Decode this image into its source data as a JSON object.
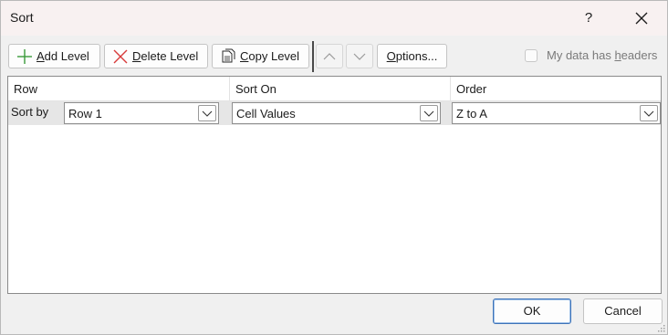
{
  "window": {
    "title": "Sort",
    "help_label": "?"
  },
  "toolbar": {
    "add_level": {
      "accel": "A",
      "rest": "dd Level"
    },
    "delete_level": {
      "accel": "D",
      "rest": "elete Level"
    },
    "copy_level": {
      "accel": "C",
      "rest": "opy Level"
    },
    "options": {
      "accel": "O",
      "rest": "ptions..."
    },
    "headers_checkbox": {
      "label_pre": "My data has ",
      "accel": "h",
      "label_post": "eaders",
      "checked": false
    }
  },
  "grid": {
    "columns": [
      "Row",
      "Sort On",
      "Order"
    ],
    "rows": [
      {
        "label": "Sort by",
        "row": "Row 1",
        "sort_on": "Cell Values",
        "order": "Z to A"
      }
    ]
  },
  "footer": {
    "ok_label": "OK",
    "cancel_label": "Cancel"
  },
  "icons": {
    "add": "plus-icon",
    "delete": "x-icon",
    "copy": "copy-icon",
    "up": "chevron-up-icon",
    "down": "chevron-down-icon",
    "dropdown": "chevron-down-icon",
    "close": "close-icon"
  },
  "colors": {
    "add_icon": "#3a9a3a",
    "delete_icon": "#d83b3b",
    "primary_border": "#3d73b8"
  }
}
